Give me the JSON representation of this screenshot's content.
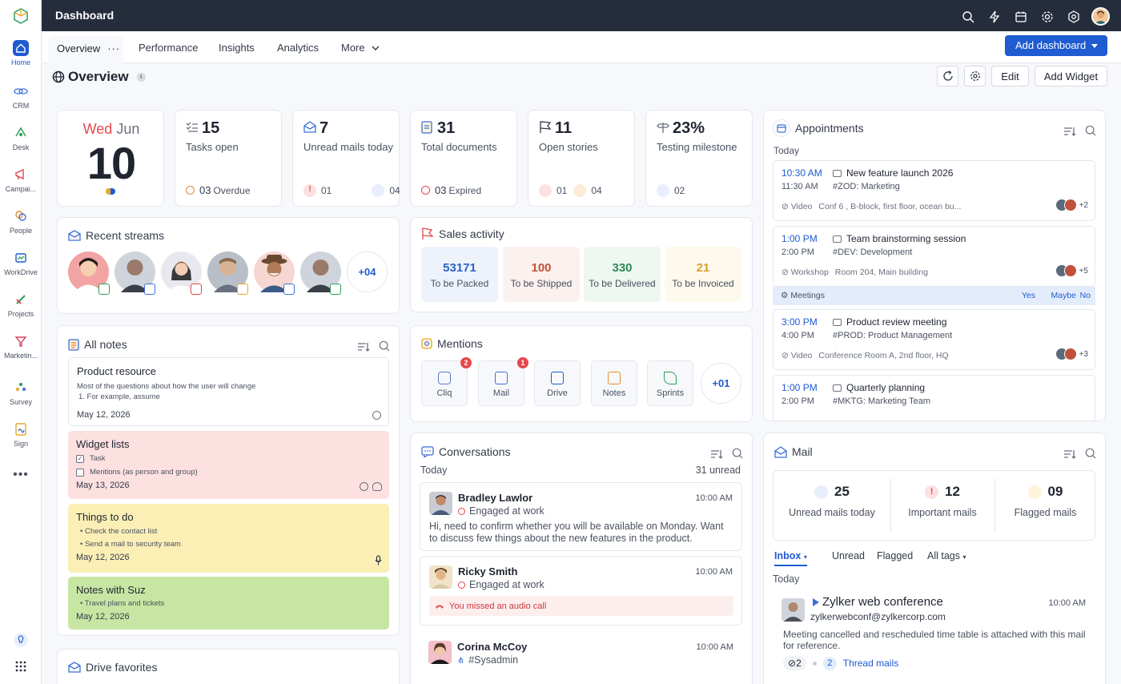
{
  "app": {
    "title": "Dashboard"
  },
  "rail": {
    "items": [
      {
        "label": "Home",
        "active": true,
        "color": "#1f5bd1"
      },
      {
        "label": "CRM",
        "color": "#3b6fd6"
      },
      {
        "label": "Desk",
        "color": "#2e9e5b"
      },
      {
        "label": "Campai...",
        "color": "#e5484d"
      },
      {
        "label": "People",
        "color": "#e58a2e"
      },
      {
        "label": "WorkDrive",
        "color": "#1f5bd1"
      },
      {
        "label": "Projects",
        "color": "#2e9e5b"
      },
      {
        "label": "Marketin...",
        "color": "#d9415d"
      },
      {
        "label": "Survey",
        "color": "#2e9e5b"
      },
      {
        "label": "Sign",
        "color": "#e5a82e"
      }
    ]
  },
  "tabs": {
    "items": [
      "Overview",
      "Performance",
      "Insights",
      "Analytics",
      "More"
    ],
    "add_dashboard": "Add dashboard"
  },
  "header": {
    "title": "Overview",
    "edit": "Edit",
    "add_widget": "Add Widget"
  },
  "date": {
    "weekday": "Wed",
    "month": "Jun",
    "day": "10"
  },
  "stats": [
    {
      "value": "15",
      "label": "Tasks open",
      "foot1": "03",
      "foot2": "Overdue"
    },
    {
      "value": "7",
      "label": "Unread mails today",
      "foot1": "01",
      "foot2": "04"
    },
    {
      "value": "31",
      "label": "Total documents",
      "foot1": "03",
      "foot2": "Expired"
    },
    {
      "value": "11",
      "label": "Open stories",
      "foot1": "01",
      "foot2": "04"
    },
    {
      "value": "23%",
      "label": "Testing milestone",
      "foot1": "02"
    }
  ],
  "streams": {
    "title": "Recent streams",
    "more": "+04"
  },
  "sales": {
    "title": "Sales activity",
    "items": [
      {
        "value": "53171",
        "label": "To be Packed",
        "color": "#2a63c7",
        "bg": "#eef3fb"
      },
      {
        "value": "100",
        "label": "To be Shipped",
        "color": "#c0513a",
        "bg": "#fbf1ee"
      },
      {
        "value": "330",
        "label": "To be Delivered",
        "color": "#2e8b57",
        "bg": "#eef7f0"
      },
      {
        "value": "21",
        "label": "To be Invoiced",
        "color": "#d9a12b",
        "bg": "#fdf9ec"
      }
    ]
  },
  "notes": {
    "title": "All notes",
    "items": [
      {
        "title": "Product resource",
        "lines": [
          "Most of the questions about how the user will change",
          "1.  For example, assume"
        ],
        "date": "May 12, 2026",
        "bg": "#ffffff"
      },
      {
        "title": "Widget lists",
        "lines": [
          "Task",
          "Mentions (as person and group)"
        ],
        "date": "May 13, 2026",
        "bg": "#fde0e0"
      },
      {
        "title": "Things to do",
        "lines": [
          "Check the contact list",
          "Send a mail to security team"
        ],
        "date": "May 12, 2026",
        "bg": "#fbefb6"
      },
      {
        "title": "Notes with Suz",
        "lines": [
          "Travel plans and tickets"
        ],
        "date": "May 12, 2026",
        "bg": "#c8e6a3"
      }
    ]
  },
  "drive": {
    "title": "Drive favorites"
  },
  "mentions": {
    "title": "Mentions",
    "items": [
      {
        "label": "Cliq",
        "badge": "2"
      },
      {
        "label": "Mail",
        "badge": "1"
      },
      {
        "label": "Drive"
      },
      {
        "label": "Notes"
      },
      {
        "label": "Sprints"
      }
    ],
    "more": "+01"
  },
  "conversations": {
    "title": "Conversations",
    "today": "Today",
    "unread": "31 unread",
    "items": [
      {
        "name": "Bradley Lawlor",
        "status": "Engaged at work",
        "time": "10:00 AM",
        "message": "Hi, need to confirm whether you will be available on Monday. Want to discuss few things about the new features in the product."
      },
      {
        "name": "Ricky Smith",
        "status": "Engaged at work",
        "time": "10:00 AM",
        "alert": "You missed an audio call"
      },
      {
        "name": "Corina McCoy",
        "status": "#Sysadmin",
        "time": "10:00 AM"
      }
    ]
  },
  "appointments": {
    "title": "Appointments",
    "today": "Today",
    "items": [
      {
        "start": "10:30 AM",
        "end": "11:30 AM",
        "title": "New feature launch 2026",
        "tag": "#ZOD: Marketing",
        "type": "Video",
        "location": "Conf 6 , B-block, first floor, ocean bu...",
        "more": "+2"
      },
      {
        "start": "1:00 PM",
        "end": "2:00 PM",
        "title": "Team brainstorming session",
        "tag": "#DEV: Development",
        "type": "Workshop",
        "location": "Room 204, Main building",
        "more": "+5"
      },
      {
        "start": "3:00 PM",
        "end": "4:00 PM",
        "title": "Product review meeting",
        "tag": "#PROD: Product Management",
        "type": "Video",
        "location": "Conference Room A, 2nd floor, HQ",
        "more": "+3"
      },
      {
        "start": "1:00 PM",
        "end": "2:00 PM",
        "title": "Quarterly planning",
        "tag": "#MKTG: Marketing Team"
      }
    ],
    "meeting_bar": {
      "label": "Meetings",
      "yes": "Yes",
      "maybe": "Maybe",
      "no": "No"
    }
  },
  "mail": {
    "title": "Mail",
    "stats": [
      {
        "value": "25",
        "label": "Unread mails today"
      },
      {
        "value": "12",
        "label": "Important mails"
      },
      {
        "value": "09",
        "label": "Flagged mails"
      }
    ],
    "tabs": [
      "Inbox",
      "Unread",
      "Flagged",
      "All tags"
    ],
    "today": "Today",
    "item": {
      "subject": "Zylker web conference",
      "from": "zylkerwebconf@zylkercorp.com",
      "time": "10:00 AM",
      "body": "Meeting cancelled and rescheduled time table is attached with this mail for reference.",
      "attachments": "2",
      "thread_count": "2",
      "thread_label": "Thread mails"
    }
  }
}
